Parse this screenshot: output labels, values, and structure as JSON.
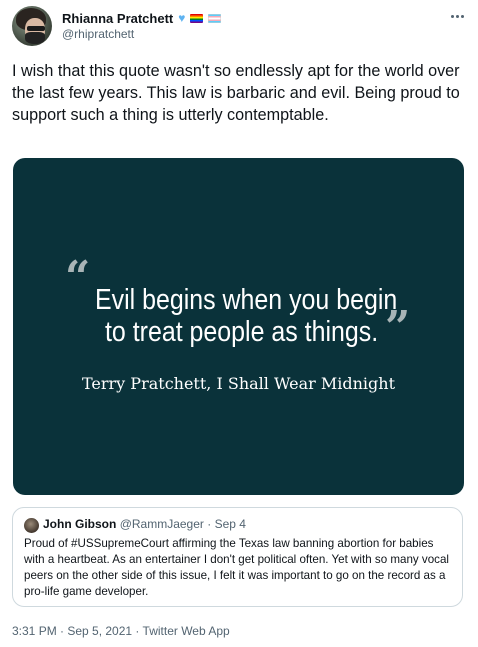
{
  "author": {
    "display_name": "Rhianna Pratchett",
    "handle": "@rhipratchett",
    "name_icons": [
      "blue-heart-icon",
      "rainbow-flag-icon",
      "trans-flag-icon"
    ]
  },
  "tweet": {
    "text": "I wish that this quote wasn't so endlessly apt for the world over the last few years. This law is barbaric and evil. Being proud to support such a thing is utterly contemptable."
  },
  "media": {
    "quote_line1": "Evil begins when you begin",
    "quote_line2": "to treat people as things.",
    "open_quote_mark": "“",
    "close_quote_mark": "”",
    "attribution": "Terry Pratchett, I Shall Wear Midnight",
    "background_color": "#0a323a"
  },
  "quoted_tweet": {
    "display_name": "John Gibson",
    "handle": "@RammJaeger",
    "separator": " · ",
    "date": "Sep 4",
    "text": "Proud of #USSupremeCourt affirming the Texas law banning abortion for babies with a heartbeat. As an entertainer I don't get political often. Yet with so many vocal peers on the other side of this issue, I felt it was important to go on the record as a pro-life game developer."
  },
  "footer": {
    "timestamp": "3:31 PM · Sep 5, 2021 · Twitter Web App"
  },
  "colors": {
    "text_primary": "#0f1419",
    "text_secondary": "#536471",
    "border": "#cfd9de"
  }
}
